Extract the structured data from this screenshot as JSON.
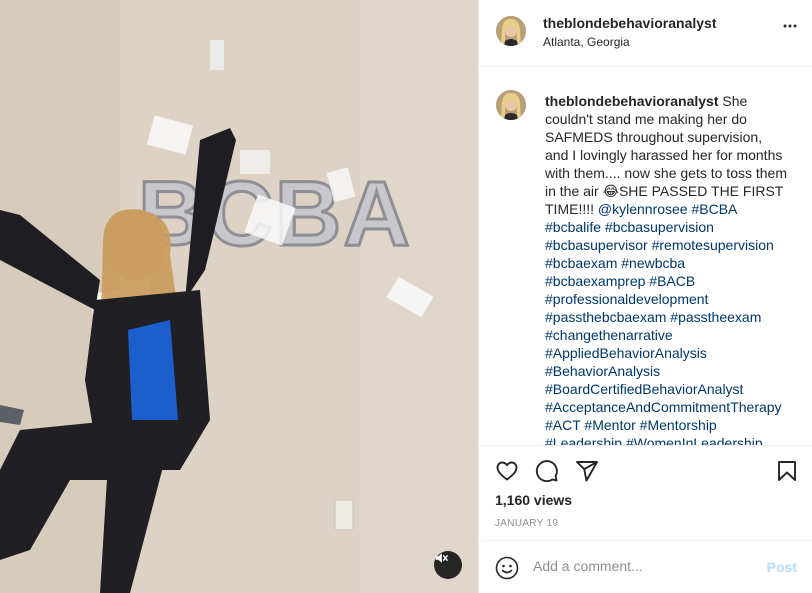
{
  "post": {
    "username": "theblondebehavioranalyst",
    "location": "Atlanta, Georgia",
    "balloon_text": "BCBA"
  },
  "caption": {
    "username": "theblondebehavioranalyst",
    "text": "She couldn't stand me making her do SAFMEDS throughout supervision, and I lovingly harassed her for months with them.... now she gets to toss them in the air 😂SHE PASSED THE FIRST TIME!!!! ",
    "mention": "@kylennrosee",
    "hashtags": "#BCBA #bcbalife #bcbasupervision #bcbasupervisor #remotesupervision #bcbaexam #newbcba #bcbaexamprep #BACB #professionaldevelopment #passthebcbaexam #passtheexam #changethenarrative #AppliedBehaviorAnalysis #BehaviorAnalysis #BoardCertifiedBehaviorAnalyst #AcceptanceAndCommitmentTherapy #ACT #Mentor #Mentorship #Leadership #WomenInLeadership"
  },
  "stats": {
    "views": "1,160 views",
    "date": "JANUARY 19"
  },
  "comment_box": {
    "placeholder": "Add a comment...",
    "post_label": "Post"
  },
  "icons": {
    "more": "more-options-icon",
    "like": "heart-icon",
    "comment": "comment-icon",
    "share": "share-icon",
    "save": "bookmark-icon",
    "emoji": "emoji-icon",
    "mute": "muted-speaker-icon"
  },
  "colors": {
    "link": "#00376b",
    "post_disabled": "#b2dffc",
    "muted_text": "#8e8e8e"
  }
}
